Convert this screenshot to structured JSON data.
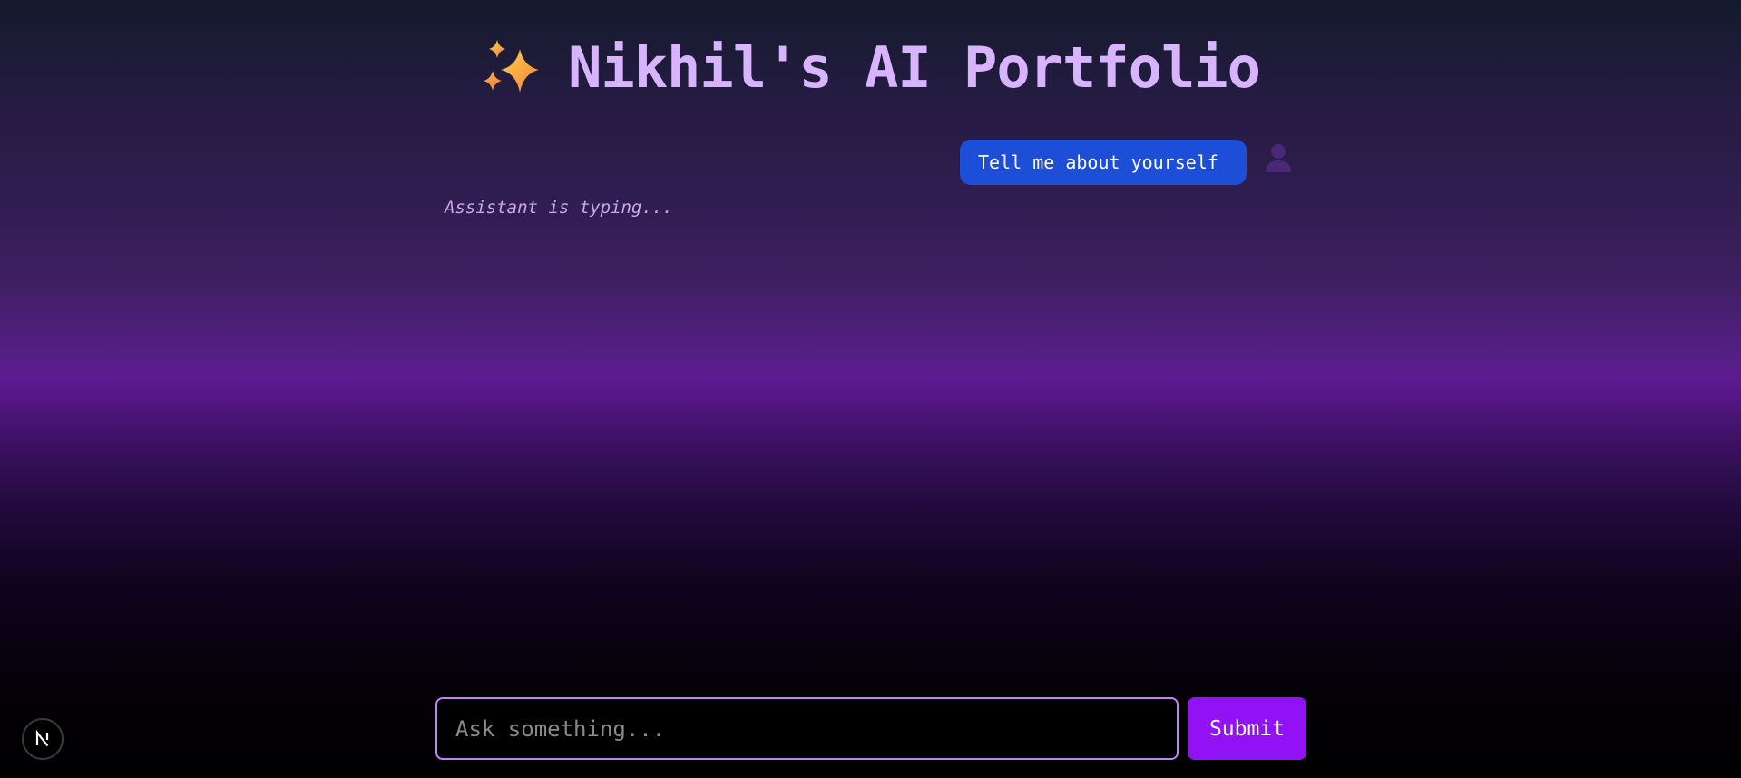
{
  "header": {
    "icon": "sparkles-icon",
    "title": "Nikhil's AI Portfolio"
  },
  "chat": {
    "messages": [
      {
        "role": "user",
        "text": "Tell me about yourself",
        "avatar": "user-avatar-icon"
      }
    ],
    "typing_indicator": "Assistant is typing..."
  },
  "composer": {
    "placeholder": "Ask something...",
    "value": "",
    "submit_label": "Submit"
  },
  "dev_badge": {
    "icon": "nextjs-logo-icon"
  },
  "colors": {
    "title": "#d8b4fe",
    "user_bubble": "#1d4ed8",
    "input_border": "#c084fc",
    "submit_button": "#9112f5",
    "typing_text": "#c9a8e8"
  }
}
